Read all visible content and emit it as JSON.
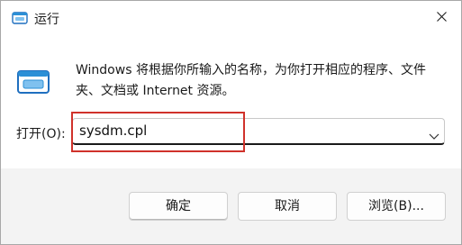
{
  "titlebar": {
    "title": "运行",
    "icon": "run-dialog-icon",
    "close_icon": "close-icon"
  },
  "dialog": {
    "icon": "run-program-icon",
    "description": "Windows 将根据你所输入的名称，为你打开相应的程序、文件夹、文档或 Internet 资源。",
    "open_label": "打开(O):",
    "open_value": "sysdm.cpl",
    "dropdown_icon": "chevron-down-icon"
  },
  "buttons": {
    "ok": "确定",
    "cancel": "取消",
    "browse": "浏览(B)..."
  },
  "colors": {
    "accent": "#0078d4",
    "highlight_border": "#d0322b",
    "icon_blue": "#2b8fd6"
  }
}
